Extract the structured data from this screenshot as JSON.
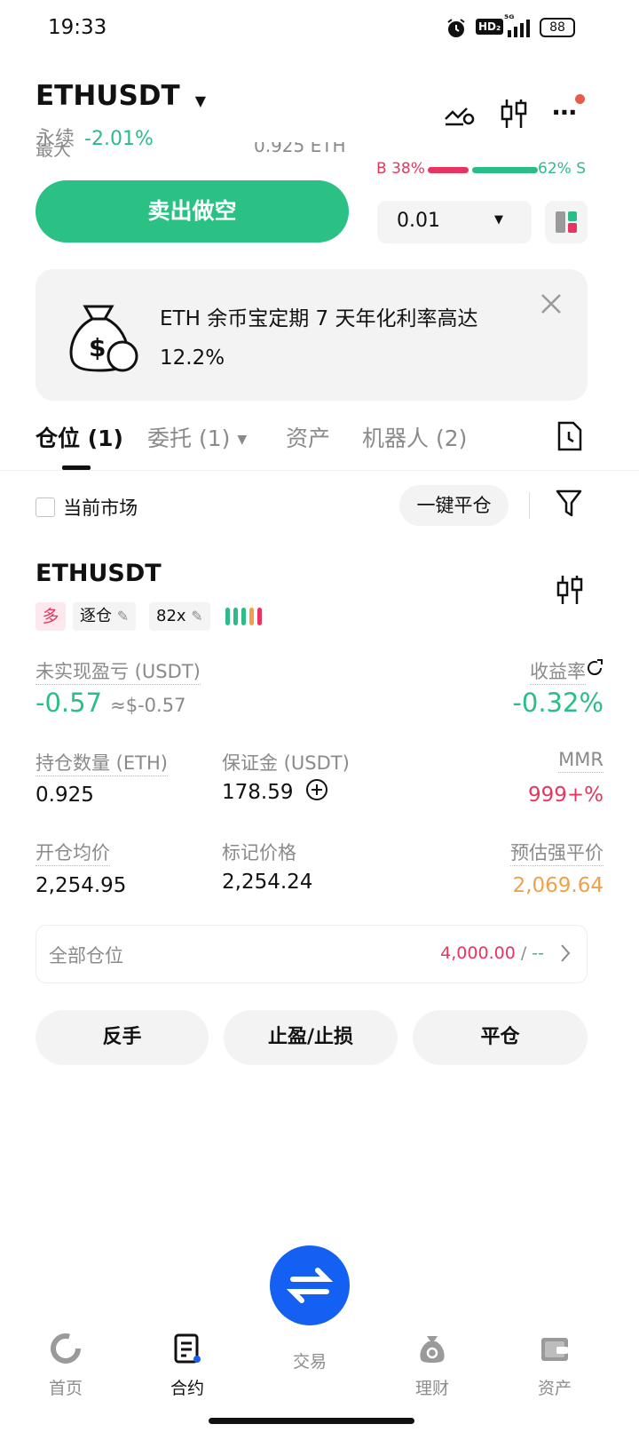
{
  "status_bar": {
    "time": "19:33",
    "network": "HD₂",
    "signal": "⁵ᴳ",
    "battery": "88"
  },
  "header": {
    "symbol": "ETHUSDT",
    "contract_type": "永续",
    "change": "-2.01%"
  },
  "order_area": {
    "partial_left": "最大",
    "partial_value": "0.925 ETH",
    "buy_ratio": "B 38%",
    "sell_ratio": "62% S",
    "buy_fraction": 0.38,
    "sell_label": "卖出做空",
    "qty_select": "0.01"
  },
  "banner": {
    "text": "ETH 余币宝定期 7 天年化利率高达 12.2%"
  },
  "tabs": [
    {
      "label": "仓位 (1)"
    },
    {
      "label": "委托 (1)"
    },
    {
      "label": "资产"
    },
    {
      "label": "机器人 (2)"
    }
  ],
  "filter_bar": {
    "current_market": "当前市场",
    "close_all": "一键平仓"
  },
  "position": {
    "symbol": "ETHUSDT",
    "side": "多",
    "margin_mode": "逐仓",
    "leverage": "82x",
    "unrealized_label": "未实现盈亏 (USDT)",
    "unrealized_value": "-0.57",
    "unrealized_usd": "≈$-0.57",
    "roe_label": "收益率",
    "roe_value": "-0.32%",
    "size_label": "持仓数量 (ETH)",
    "size_value": "0.925",
    "margin_label": "保证金 (USDT)",
    "margin_value": "178.59",
    "mmr_label": "MMR",
    "mmr_value": "999+%",
    "entry_label": "开仓均价",
    "entry_value": "2,254.95",
    "mark_label": "标记价格",
    "mark_value": "2,254.24",
    "liq_label": "预估强平价",
    "liq_value": "2,069.64",
    "all_positions_label": "全部仓位",
    "all_positions_value": "4,000.00",
    "all_positions_sep": "/",
    "all_positions_dash": "--",
    "btn_reverse": "反手",
    "btn_tpsl": "止盈/止损",
    "btn_close": "平仓"
  },
  "bottom_nav": [
    {
      "label": "首页"
    },
    {
      "label": "合约"
    },
    {
      "label": "交易"
    },
    {
      "label": "理财"
    },
    {
      "label": "资产"
    }
  ],
  "colors": {
    "green": "#2bbd86",
    "red": "#e6365f",
    "orange": "#f0a04b",
    "blue": "#1460f2"
  }
}
